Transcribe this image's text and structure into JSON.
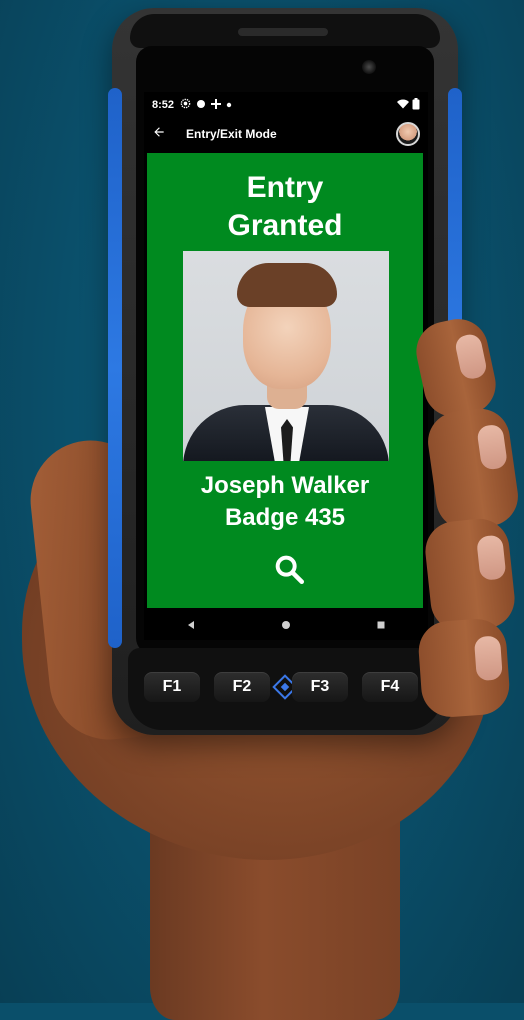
{
  "status_bar": {
    "time": "8:52"
  },
  "app_bar": {
    "title": "Entry/Exit Mode"
  },
  "access_result": {
    "title": "Entry\nGranted",
    "name": "Joseph Walker",
    "badge": "Badge 435"
  },
  "hardware_keys": [
    {
      "label": "F1"
    },
    {
      "label": "F2"
    },
    {
      "label": "F3"
    },
    {
      "label": "F4"
    }
  ],
  "colors": {
    "success_green": "#008a1f",
    "device_blue": "#2d79e3",
    "screen_black": "#000000",
    "background": "#0a4f6a"
  }
}
